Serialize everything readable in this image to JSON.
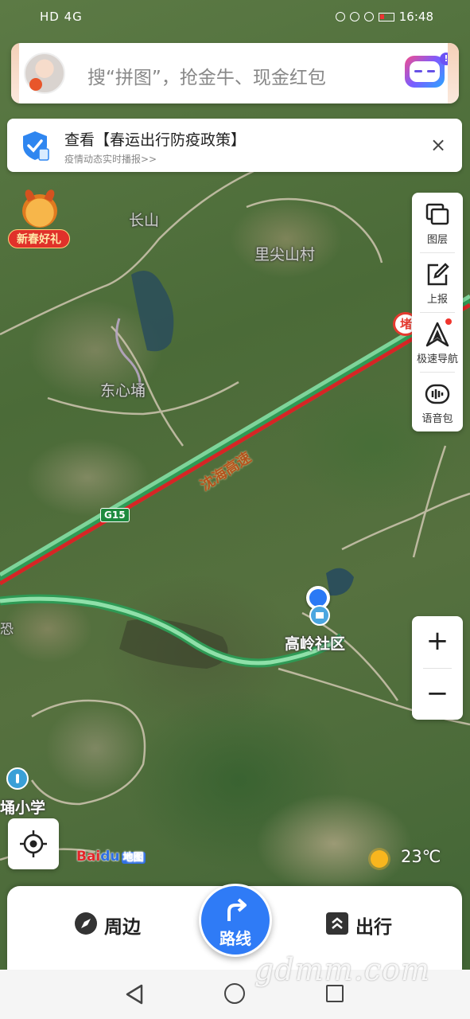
{
  "status_bar": {
    "left": "HD  4G",
    "time": "16:48"
  },
  "search": {
    "placeholder": "搜“拼图”，抢金牛、现金红包",
    "robot_badge": "!"
  },
  "notice": {
    "title": "查看【春运出行防疫政策】",
    "subtitle": "疫情动态实时播报>>",
    "close": "×"
  },
  "promo": {
    "label": "新春好礼"
  },
  "tools": [
    {
      "label": "图层",
      "icon": "layers-icon"
    },
    {
      "label": "上报",
      "icon": "report-edit-icon"
    },
    {
      "label": "极速导航",
      "icon": "navigation-arrow-icon"
    },
    {
      "label": "语音包",
      "icon": "voice-pack-icon"
    }
  ],
  "map": {
    "labels": {
      "changshan": "长山",
      "lijianshancun": "里尖山村",
      "dongxinyong": "东心埇",
      "gaolingshequ": "高岭社区",
      "yongxiaoxue": "埇小学",
      "road_name": "沈海高速",
      "highway_shield": "G15",
      "toll": "堵",
      "edge_left": "恐"
    }
  },
  "zoom": {
    "in": "+",
    "out": "−"
  },
  "logo": {
    "brand": "Bai",
    "paw": "du",
    "suffix": "地图"
  },
  "weather": {
    "temperature": "23℃"
  },
  "bottom": {
    "nearby": "周边",
    "route": "路线",
    "travel": "出行"
  },
  "watermark": "gdmm.com"
}
